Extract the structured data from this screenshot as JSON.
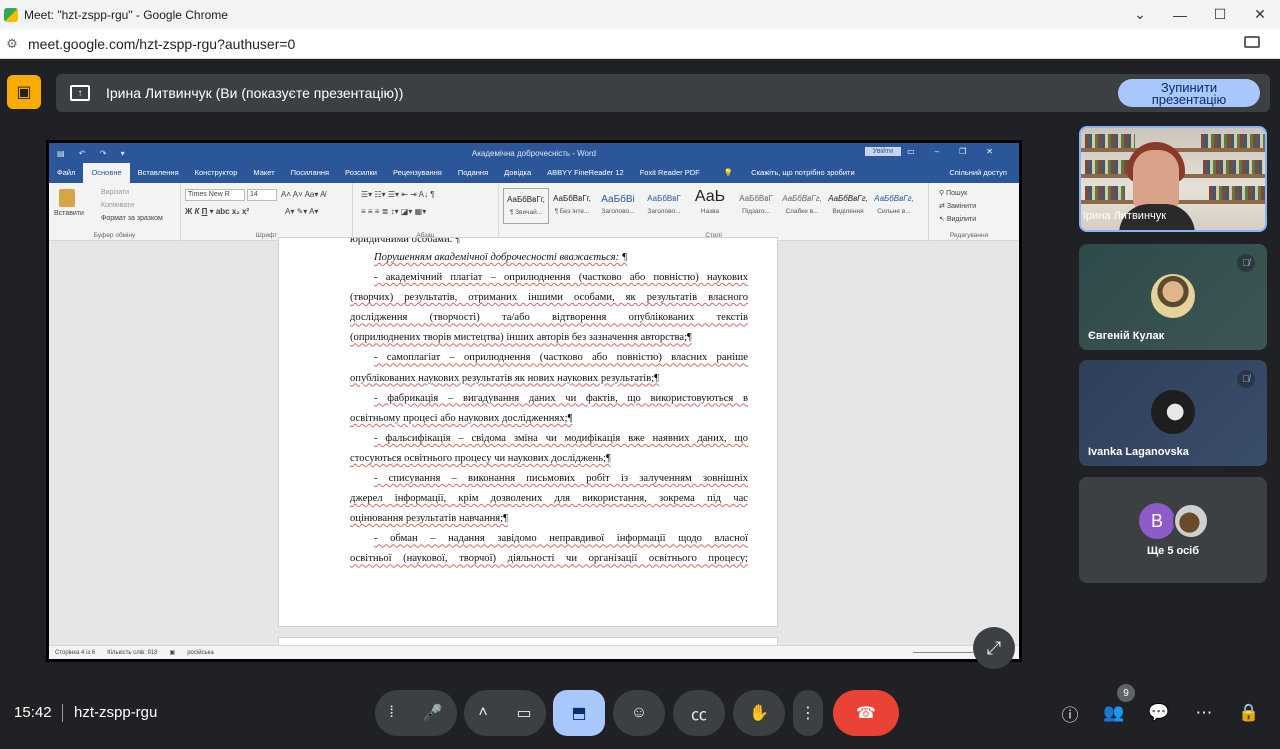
{
  "browser": {
    "window_title": "Meet: \"hzt-zspp-rgu\" - Google Chrome",
    "url": "meet.google.com/hzt-zspp-rgu?authuser=0"
  },
  "banner": {
    "presenter_text": "Ірина Литвинчук (Ви (показуєте презентацію))",
    "stop_line1": "Зупинити",
    "stop_line2": "презентацію"
  },
  "word": {
    "doc_title": "Академічна доброчесність  -  Word",
    "sign_in": "Увійти",
    "tabs": [
      "Файл",
      "Основне",
      "Вставлення",
      "Конструктор",
      "Макет",
      "Посилання",
      "Розсилки",
      "Рецензування",
      "Подання",
      "Довідка",
      "ABBYY FineReader 12",
      "Foxit Reader PDF",
      "Скажіть, що потрібно зробити"
    ],
    "share": "Спільний доступ",
    "clipboard": {
      "paste": "Вставити",
      "cut": "Вирізати",
      "copy": "Копіювати",
      "format_painter": "Формат за зразком",
      "label": "Буфер обміну"
    },
    "font": {
      "name": "Times New R",
      "size": "14",
      "label": "Шрифт"
    },
    "paragraph_label": "Абзац",
    "styles": [
      {
        "preview": "АаБбВвГг,",
        "name": "¶ Звичай..."
      },
      {
        "preview": "АаБбВвГг,",
        "name": "¶ Без інте..."
      },
      {
        "preview": "АаБбВі",
        "name": "Заголово..."
      },
      {
        "preview": "АаБбВвГ",
        "name": "Заголово..."
      },
      {
        "preview": "АаЬ",
        "name": "Назва"
      },
      {
        "preview": "АаБбВвГ",
        "name": "Підзаго..."
      },
      {
        "preview": "АаБбВвГг,",
        "name": "Слабке в..."
      },
      {
        "preview": "АаБбВвГг,",
        "name": "Виділення"
      },
      {
        "preview": "АаБбВвГг,",
        "name": "Сильне в..."
      }
    ],
    "styles_label": "Стилі",
    "editing": {
      "find": "Пошук",
      "replace": "Замінити",
      "select": "Виділити",
      "label": "Редагування"
    },
    "lines": [
      "юридичними особами. ¶",
      "Порушенням академічної доброчесності вважається: ¶",
      "- академічний плагіат – оприлюднення (частково або повністю) наукових",
      "(творчих) результатів, отриманих іншими особами, як результатів власного",
      "дослідження (творчості) та/або відтворення опублікованих текстів",
      "(оприлюднених творів мистецтва) інших авторів без зазначення авторства;¶",
      "- самоплагіат – оприлюднення (частково або повністю) власних раніше",
      "опублікованих наукових результатів як нових наукових результатів;¶",
      "- фабрикація – вигадування даних чи фактів, що використовуються в",
      "освітньому процесі або наукових дослідженнях;¶",
      "- фальсифікація – свідома зміна чи модифікація вже наявних даних, що",
      "стосуються освітнього процесу чи наукових досліджень;¶",
      "- списування – виконання письмових робіт із залученням зовнішніх",
      "джерел інформації, крім дозволених для використання, зокрема під час",
      "оцінювання результатів навчання;¶",
      "- обман – надання завідомо неправдивої інформації щодо власної",
      "освітньої (наукової, творчої) діяльності чи організації освітнього процесу;"
    ],
    "status": {
      "page": "Сторінка 4 із 6",
      "words": "Кількість слів: 918",
      "language": "російська"
    }
  },
  "participants": [
    {
      "name": "Ірина Литвинчук"
    },
    {
      "name": "Євгеній Кулак"
    },
    {
      "name": "Ivanka Laganovska"
    }
  ],
  "more": {
    "initial": "В",
    "label": "Ще 5 осіб"
  },
  "bottom": {
    "time": "15:42",
    "meeting_code": "hzt-zspp-rgu",
    "people_count": "9"
  },
  "colors": {
    "meet_bg": "#202124",
    "accent": "#a8c7fa",
    "end_call": "#ea4335",
    "word_blue": "#2b579a"
  }
}
